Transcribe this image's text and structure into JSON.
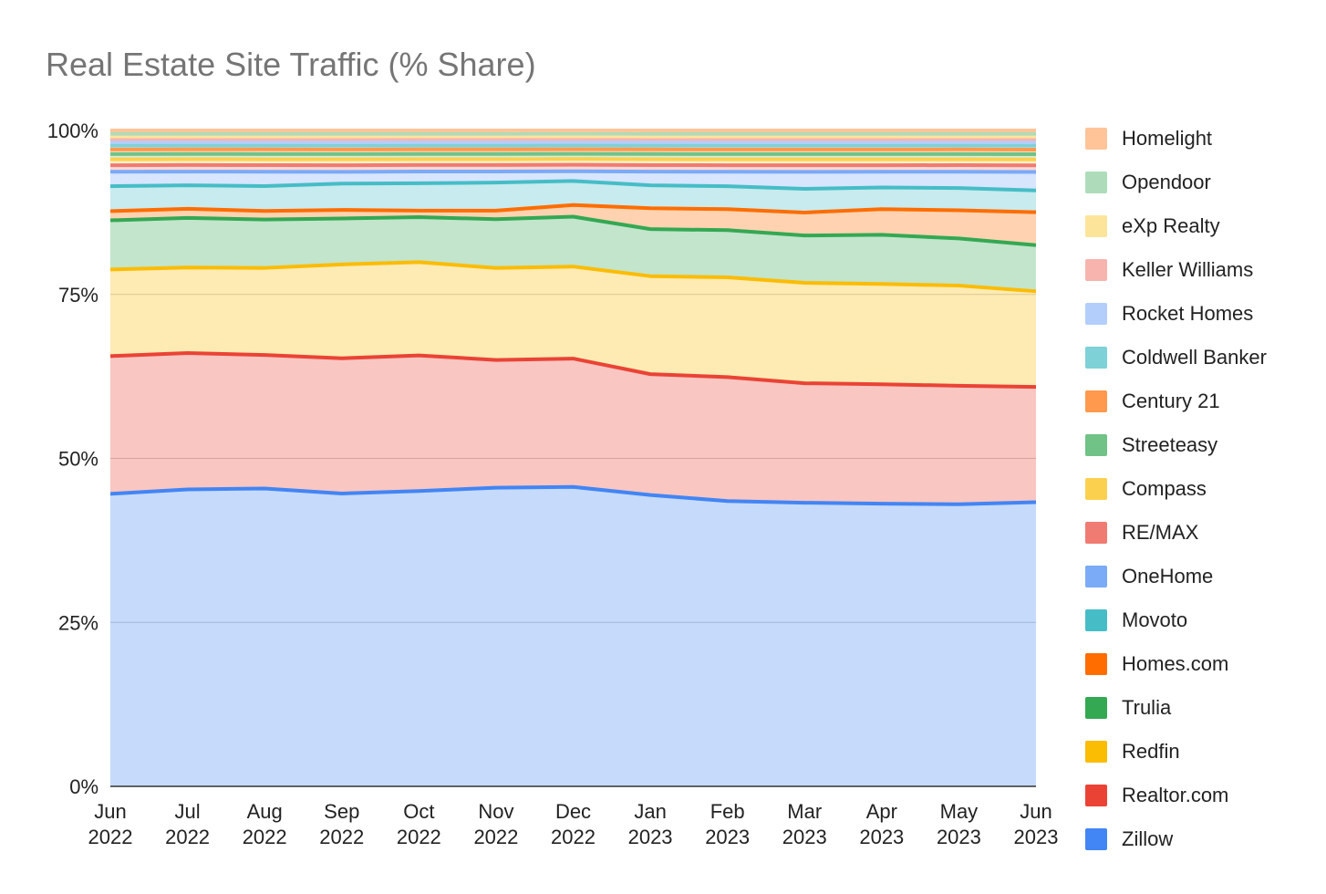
{
  "chart_data": {
    "type": "area",
    "stacked": true,
    "title": "Real Estate Site Traffic (% Share)",
    "xlabel": "",
    "ylabel": "",
    "ylim": [
      0,
      100
    ],
    "y_ticks": [
      "0%",
      "25%",
      "50%",
      "75%",
      "100%"
    ],
    "y_tick_values": [
      0,
      25,
      50,
      75,
      100
    ],
    "grid": true,
    "legend_position": "right",
    "categories": [
      [
        "Jun",
        "2022"
      ],
      [
        "Jul",
        "2022"
      ],
      [
        "Aug",
        "2022"
      ],
      [
        "Sep",
        "2022"
      ],
      [
        "Oct",
        "2022"
      ],
      [
        "Nov",
        "2022"
      ],
      [
        "Dec",
        "2022"
      ],
      [
        "Jan",
        "2023"
      ],
      [
        "Feb",
        "2023"
      ],
      [
        "Mar",
        "2023"
      ],
      [
        "Apr",
        "2023"
      ],
      [
        "May",
        "2023"
      ],
      [
        "Jun",
        "2023"
      ]
    ],
    "series": [
      {
        "name": "Zillow",
        "color": "#4285f4",
        "values": [
          44.6,
          45.5,
          45.5,
          44.6,
          45.3,
          45.8,
          46.2,
          44.6,
          43.5,
          43.2,
          43.1,
          43.1,
          43.1
        ]
      },
      {
        "name": "Realtor.com",
        "color": "#ea4335",
        "values": [
          21.0,
          20.9,
          20.4,
          20.6,
          20.8,
          19.6,
          19.8,
          18.5,
          18.9,
          18.2,
          18.2,
          18.1,
          17.5
        ]
      },
      {
        "name": "Redfin",
        "color": "#fbbc04",
        "values": [
          13.2,
          13.1,
          13.3,
          14.3,
          14.3,
          14.1,
          14.2,
          15.0,
          15.2,
          15.3,
          15.3,
          15.3,
          14.5
        ]
      },
      {
        "name": "Trulia",
        "color": "#34a853",
        "values": [
          7.5,
          7.6,
          7.4,
          7.0,
          6.9,
          7.5,
          7.7,
          7.2,
          7.2,
          7.2,
          7.5,
          7.2,
          7.0
        ]
      },
      {
        "name": "Homes.com",
        "color": "#ff6d01",
        "values": [
          1.4,
          1.4,
          1.3,
          1.3,
          1.0,
          1.3,
          1.8,
          3.2,
          3.2,
          3.5,
          3.9,
          4.3,
          5.0
        ]
      },
      {
        "name": "Movoto",
        "color": "#46bdc6",
        "values": [
          3.8,
          3.6,
          3.8,
          4.0,
          4.2,
          4.3,
          3.7,
          3.5,
          3.5,
          3.6,
          3.3,
          3.4,
          3.3
        ]
      },
      {
        "name": "OneHome",
        "color": "#7baaf7",
        "values": [
          2.2,
          2.1,
          2.2,
          1.8,
          1.8,
          1.7,
          1.5,
          2.1,
          2.2,
          2.6,
          2.4,
          2.5,
          2.8
        ]
      },
      {
        "name": "RE/MAX",
        "color": "#f07b72",
        "values": [
          1.0,
          1.0,
          1.0,
          1.0,
          1.0,
          1.0,
          1.0,
          1.0,
          1.0,
          1.0,
          1.0,
          1.0,
          1.0
        ]
      },
      {
        "name": "Compass",
        "color": "#fcd04f",
        "values": [
          0.9,
          0.9,
          0.9,
          0.9,
          0.9,
          0.9,
          0.9,
          0.9,
          0.9,
          0.9,
          0.9,
          0.9,
          0.9
        ]
      },
      {
        "name": "Streeteasy",
        "color": "#71c287",
        "values": [
          0.8,
          0.8,
          0.8,
          0.8,
          0.8,
          0.8,
          0.8,
          0.8,
          0.8,
          0.8,
          0.8,
          0.8,
          0.8
        ]
      },
      {
        "name": "Century 21",
        "color": "#ff994d",
        "values": [
          0.7,
          0.7,
          0.7,
          0.7,
          0.7,
          0.7,
          0.7,
          0.7,
          0.7,
          0.7,
          0.7,
          0.7,
          0.7
        ]
      },
      {
        "name": "Coldwell Banker",
        "color": "#7ed1d7",
        "values": [
          0.6,
          0.6,
          0.6,
          0.6,
          0.6,
          0.6,
          0.6,
          0.6,
          0.6,
          0.6,
          0.6,
          0.6,
          0.6
        ]
      },
      {
        "name": "Rocket Homes",
        "color": "#b3cefb",
        "values": [
          0.5,
          0.5,
          0.5,
          0.5,
          0.5,
          0.5,
          0.5,
          0.5,
          0.5,
          0.5,
          0.5,
          0.5,
          0.5
        ]
      },
      {
        "name": "Keller Williams",
        "color": "#f7b4ae",
        "values": [
          0.5,
          0.5,
          0.5,
          0.5,
          0.5,
          0.5,
          0.5,
          0.5,
          0.5,
          0.5,
          0.5,
          0.5,
          0.5
        ]
      },
      {
        "name": "eXp Realty",
        "color": "#fde49b",
        "values": [
          0.4,
          0.4,
          0.4,
          0.4,
          0.4,
          0.4,
          0.4,
          0.4,
          0.4,
          0.4,
          0.4,
          0.4,
          0.4
        ]
      },
      {
        "name": "Opendoor",
        "color": "#aedcba",
        "values": [
          0.4,
          0.4,
          0.4,
          0.4,
          0.4,
          0.4,
          0.4,
          0.4,
          0.4,
          0.4,
          0.4,
          0.4,
          0.4
        ]
      },
      {
        "name": "Homelight",
        "color": "#ffc599",
        "values": [
          0.5,
          0.5,
          0.5,
          0.5,
          0.5,
          0.5,
          0.5,
          0.5,
          0.5,
          0.5,
          0.5,
          0.5,
          0.5
        ]
      }
    ]
  }
}
